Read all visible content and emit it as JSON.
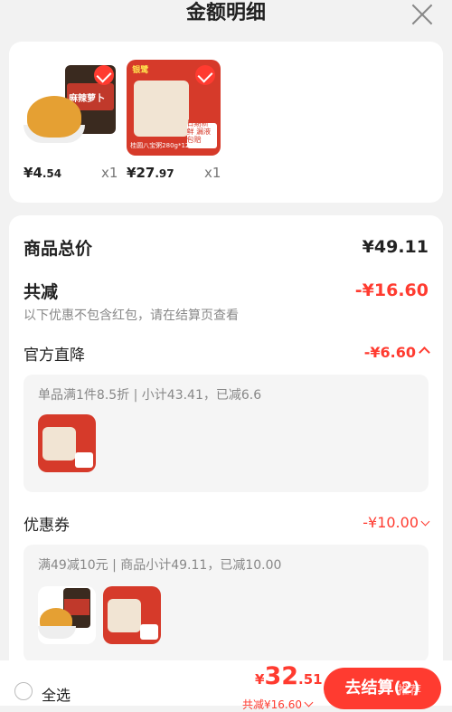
{
  "header": {
    "title": "金额明细"
  },
  "items": [
    {
      "price_cur": "¥",
      "price_int": "4",
      "price_dec": ".54",
      "qty": "x1",
      "label": "麻辣萝卜"
    },
    {
      "price_cur": "¥",
      "price_int": "27",
      "price_dec": ".97",
      "qty": "x1",
      "label": "银鹭",
      "tag": "日期新鲜 漏液包赔",
      "bottom_text": "桂圆八宝粥280g*12罐"
    }
  ],
  "summary": {
    "goods_total_label": "商品总价",
    "goods_total_value": "¥49.11",
    "reduce_label": "共减",
    "reduce_value": "-¥16.60",
    "note": "以下优惠不包含红包，请在结算页查看"
  },
  "sections": [
    {
      "label": "官方直降",
      "value": "-¥6.60",
      "detail": "单品满1件8.5折 | 小计43.41，已减6.6"
    },
    {
      "label": "优惠券",
      "value": "-¥10.00",
      "detail": "满49减10元 | 商品小计49.11，已减10.00"
    }
  ],
  "bottom": {
    "select_all": "全选",
    "total_cur": "¥",
    "total_int": "32",
    "total_dec": ".51",
    "total_sub": "共减¥16.60",
    "checkout": "去结算(2)",
    "recommend": "推荐"
  },
  "colors": {
    "accent": "#ff3b30"
  }
}
